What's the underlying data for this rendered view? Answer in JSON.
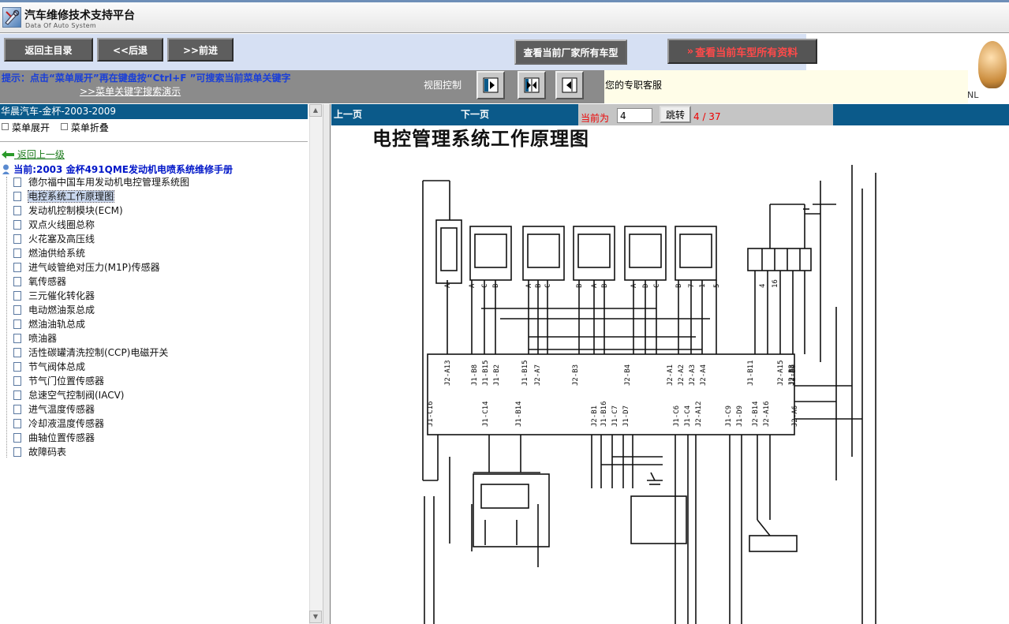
{
  "app": {
    "title": "汽车维修技术支持平台",
    "subtitle": "Data Of Auto System"
  },
  "nav": {
    "home": "返回主目录",
    "back": "<<后退",
    "forward": ">>前进",
    "all_models_current_maker": "查看当前厂家所有车型",
    "all_data_current_model_prefix": "»",
    "all_data_current_model": "查看当前车型所有资料"
  },
  "hint": {
    "text": "提示：点击“菜单展开”再在键盘按“Ctrl+F ”可搜索当前菜单关键字",
    "demo_link": ">>菜单关键字搜索演示"
  },
  "view_control": {
    "label": "视图控制",
    "icons": [
      "expand-right-icon",
      "split-view-icon",
      "collapse-left-icon"
    ]
  },
  "service": {
    "text": "您的专职客服",
    "nl": "NL"
  },
  "left_panel": {
    "header": "华晨汽车-金杯-2003-2009",
    "expand": "菜单展开",
    "collapse": "菜单折叠",
    "back_up": "返回上一级",
    "current": "当前:2003 金杯491QME发动机电喷系统维修手册",
    "items": [
      "德尔福中国车用发动机电控管理系统图",
      "电控系统工作原理图",
      "发动机控制模块(ECM)",
      "双点火线圈总称",
      "火花塞及高压线",
      "燃油供给系统",
      "进气岐管绝对压力(M1P)传感器",
      "氧传感器",
      "三元催化转化器",
      "电动燃油泵总成",
      "燃油油轨总成",
      "喷油器",
      "活性碳罐清洗控制(CCP)电磁开关",
      "节气阀体总成",
      "节气门位置传感器",
      "怠速空气控制阀(IACV)",
      "进气温度传感器",
      "冷却液温度传感器",
      "曲轴位置传感器",
      "故障码表"
    ],
    "selected_index": 1
  },
  "pager": {
    "prev": "上一页",
    "next": "下一页",
    "current_label": "当前为",
    "current_value": "4",
    "jump": "跳转",
    "count": "4 / 37"
  },
  "document": {
    "title": "电控管理系统工作原理图",
    "pin_labels_top": [
      "A",
      "A",
      "C",
      "B",
      "A",
      "B",
      "C",
      "B",
      "A",
      "B",
      "A",
      "D",
      "C",
      "B",
      "7",
      "1",
      "5",
      "4",
      "16"
    ],
    "pin_labels_ecm": [
      "J2-A13",
      "J1-B8",
      "J1-B15",
      "J1-B2",
      "J1-B15",
      "J2-A7",
      "J2-B3",
      "J2-B4",
      "J2-A1",
      "J2-A2",
      "J2-A3",
      "J2-A4",
      "J1-B11",
      "J2-B3",
      "J2-B6",
      "J2-A15",
      "J2-A8"
    ],
    "pin_labels_ecm_bottom": [
      "J1-C16",
      "J1-C14",
      "J1-B14",
      "J2-B1",
      "J1-B16",
      "J1-C7",
      "J1-D7",
      "J1-C6",
      "J1-C4",
      "J2-A12",
      "J1-C9",
      "J1-D9",
      "J2-B14",
      "J2-A16",
      "J2-A6"
    ]
  }
}
